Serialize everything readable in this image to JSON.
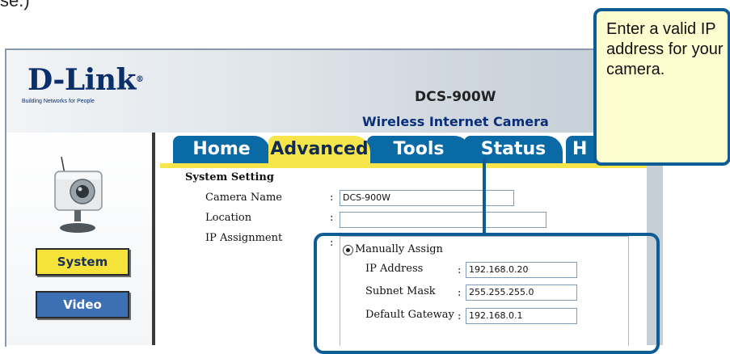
{
  "header": {
    "brand": "D-Link",
    "tagline": "Building Networks for People",
    "model": "DCS-900W",
    "subtitle": "Wireless Internet Camera"
  },
  "nav": {
    "system_label": "System",
    "video_label": "Video"
  },
  "tabs": [
    {
      "label": "Home"
    },
    {
      "label": "Advanced",
      "active": true
    },
    {
      "label": "Tools"
    },
    {
      "label": "Status"
    },
    {
      "label": "H"
    }
  ],
  "form": {
    "section_title": "System Setting",
    "camera_name_label": "Camera Name",
    "camera_name_value": "DCS-900W",
    "location_label": "Location",
    "location_value": "",
    "ip_assignment_label": "IP Assignment",
    "manual_assign_label": "Manually Assign",
    "ip_address_label": "IP Address",
    "ip_address_value": "192.168.0.20",
    "subnet_mask_label": "Subnet Mask",
    "subnet_mask_value": "255.255.255.0",
    "gateway_label": "Default Gateway",
    "gateway_value": "192.168.0.1",
    "colon": ":"
  },
  "callout": {
    "text": "Enter a valid IP address for your camera."
  },
  "colors": {
    "tab_blue": "#0a6aa6",
    "tab_active": "#f7e64b",
    "callout_border": "#0d5d94",
    "callout_bg": "#fefdd0"
  }
}
